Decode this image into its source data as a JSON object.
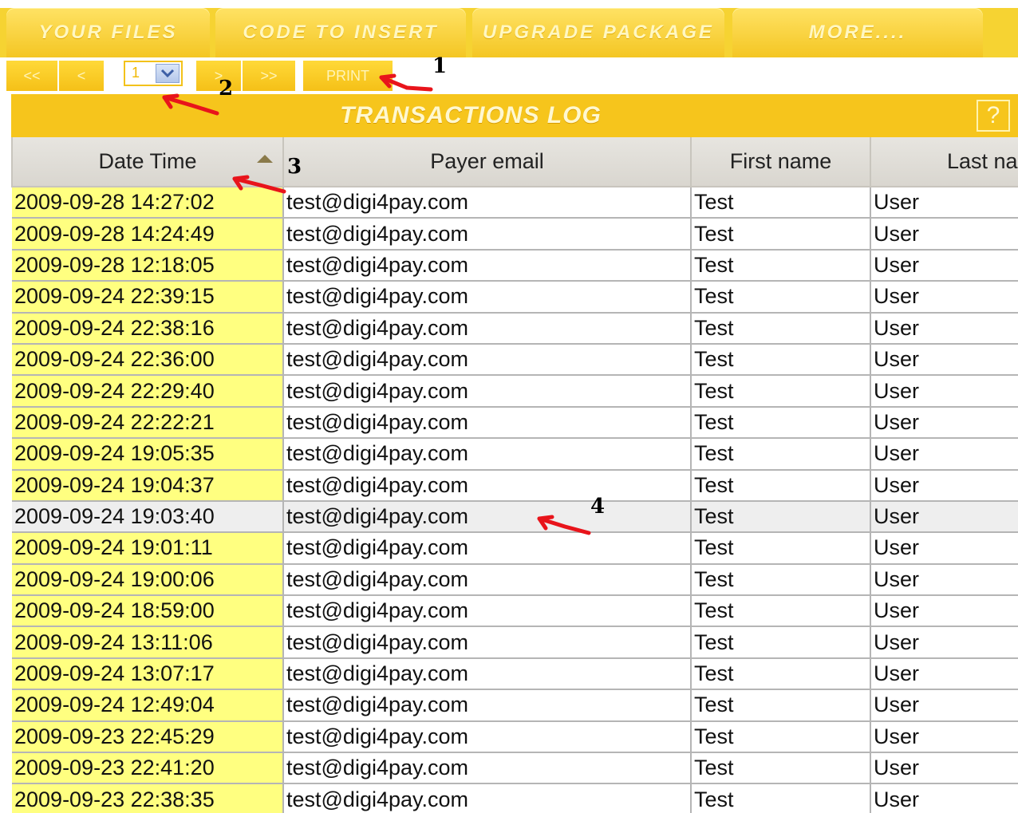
{
  "tabs": [
    {
      "label": "YOUR FILES"
    },
    {
      "label": "CODE TO INSERT"
    },
    {
      "label": "UPGRADE PACKAGE"
    },
    {
      "label": "MORE...."
    }
  ],
  "nav": {
    "first": "<<",
    "prev": "<",
    "page_value": "1",
    "next": ">",
    "last": ">>",
    "print": "PRINT"
  },
  "title": "TRANSACTIONS LOG",
  "help": "?",
  "table": {
    "columns": [
      "Date Time",
      "Payer email",
      "First name",
      "Last na"
    ],
    "rows": [
      [
        "2009-09-28 14:27:02",
        "test@digi4pay.com",
        "Test",
        "User"
      ],
      [
        "2009-09-28 14:24:49",
        "test@digi4pay.com",
        "Test",
        "User"
      ],
      [
        "2009-09-28 12:18:05",
        "test@digi4pay.com",
        "Test",
        "User"
      ],
      [
        "2009-09-24 22:39:15",
        "test@digi4pay.com",
        "Test",
        "User"
      ],
      [
        "2009-09-24 22:38:16",
        "test@digi4pay.com",
        "Test",
        "User"
      ],
      [
        "2009-09-24 22:36:00",
        "test@digi4pay.com",
        "Test",
        "User"
      ],
      [
        "2009-09-24 22:29:40",
        "test@digi4pay.com",
        "Test",
        "User"
      ],
      [
        "2009-09-24 22:22:21",
        "test@digi4pay.com",
        "Test",
        "User"
      ],
      [
        "2009-09-24 19:05:35",
        "test@digi4pay.com",
        "Test",
        "User"
      ],
      [
        "2009-09-24 19:04:37",
        "test@digi4pay.com",
        "Test",
        "User"
      ],
      [
        "2009-09-24 19:03:40",
        "test@digi4pay.com",
        "Test",
        "User"
      ],
      [
        "2009-09-24 19:01:11",
        "test@digi4pay.com",
        "Test",
        "User"
      ],
      [
        "2009-09-24 19:00:06",
        "test@digi4pay.com",
        "Test",
        "User"
      ],
      [
        "2009-09-24 18:59:00",
        "test@digi4pay.com",
        "Test",
        "User"
      ],
      [
        "2009-09-24 13:11:06",
        "test@digi4pay.com",
        "Test",
        "User"
      ],
      [
        "2009-09-24 13:07:17",
        "test@digi4pay.com",
        "Test",
        "User"
      ],
      [
        "2009-09-24 12:49:04",
        "test@digi4pay.com",
        "Test",
        "User"
      ],
      [
        "2009-09-23 22:45:29",
        "test@digi4pay.com",
        "Test",
        "User"
      ],
      [
        "2009-09-23 22:41:20",
        "test@digi4pay.com",
        "Test",
        "User"
      ],
      [
        "2009-09-23 22:38:35",
        "test@digi4pay.com",
        "Test",
        "User"
      ]
    ],
    "highlight_row": 10
  },
  "annotations": [
    "1",
    "2",
    "3",
    "4"
  ],
  "colors": {
    "accent": "#f6c51c",
    "date_cell": "#ffff80",
    "arrow": "#e8141b"
  }
}
